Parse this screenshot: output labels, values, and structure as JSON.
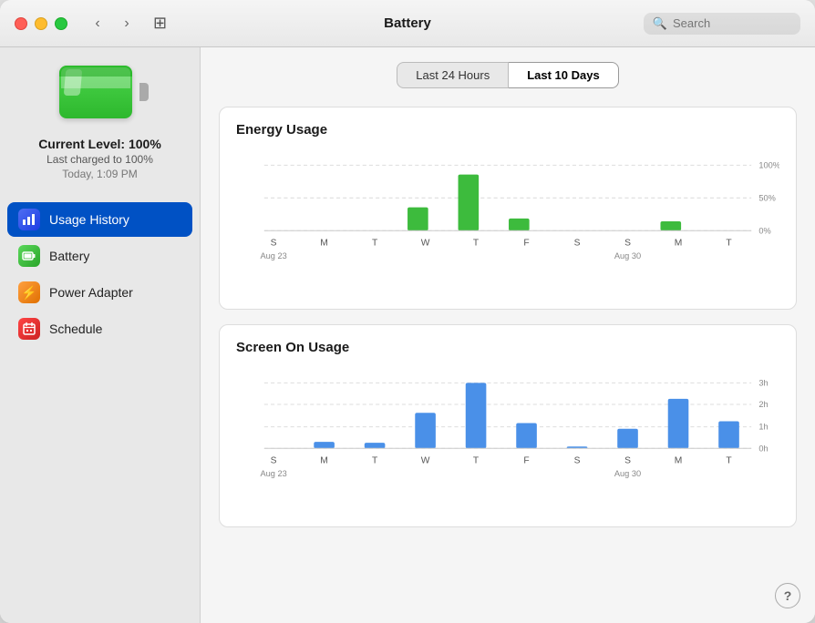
{
  "window": {
    "title": "Battery"
  },
  "titlebar": {
    "back_label": "‹",
    "forward_label": "›",
    "grid_icon": "⊞",
    "search_placeholder": "Search"
  },
  "sidebar": {
    "battery_level_label": "Current Level: 100%",
    "battery_charged_label": "Last charged to 100%",
    "battery_time_label": "Today, 1:09 PM",
    "nav_items": [
      {
        "id": "usage-history",
        "label": "Usage History",
        "icon": "📊",
        "icon_class": "icon-usage",
        "active": true
      },
      {
        "id": "battery",
        "label": "Battery",
        "icon": "🔋",
        "icon_class": "icon-battery-sm",
        "active": false
      },
      {
        "id": "power-adapter",
        "label": "Power Adapter",
        "icon": "⚡",
        "icon_class": "icon-power",
        "active": false
      },
      {
        "id": "schedule",
        "label": "Schedule",
        "icon": "📅",
        "icon_class": "icon-schedule",
        "active": false
      }
    ]
  },
  "tabs": [
    {
      "id": "last-24h",
      "label": "Last 24 Hours",
      "active": false
    },
    {
      "id": "last-10d",
      "label": "Last 10 Days",
      "active": true
    }
  ],
  "energy_chart": {
    "title": "Energy Usage",
    "y_labels": [
      "100%",
      "50%",
      "0%"
    ],
    "x_labels": [
      "S",
      "M",
      "T",
      "W",
      "T",
      "F",
      "S",
      "S",
      "M",
      "T"
    ],
    "x_dates": [
      "Aug 23",
      "",
      "",
      "",
      "",
      "",
      "",
      "Aug 30",
      "",
      ""
    ],
    "bars": [
      {
        "day": "S",
        "value": 0
      },
      {
        "day": "M",
        "value": 0
      },
      {
        "day": "T",
        "value": 0
      },
      {
        "day": "W",
        "value": 35
      },
      {
        "day": "T",
        "value": 85
      },
      {
        "day": "F",
        "value": 18
      },
      {
        "day": "S",
        "value": 0
      },
      {
        "day": "S",
        "value": 0
      },
      {
        "day": "M",
        "value": 14
      },
      {
        "day": "T",
        "value": 0
      }
    ],
    "bar_color": "#3dbb3d"
  },
  "screen_chart": {
    "title": "Screen On Usage",
    "y_labels": [
      "3h",
      "2h",
      "1h",
      "0h"
    ],
    "x_labels": [
      "S",
      "M",
      "T",
      "W",
      "T",
      "F",
      "S",
      "S",
      "M",
      "T"
    ],
    "x_dates": [
      "Aug 23",
      "",
      "",
      "",
      "",
      "",
      "",
      "Aug 30",
      "",
      ""
    ],
    "bars": [
      {
        "day": "S",
        "value": 0
      },
      {
        "day": "M",
        "value": 10
      },
      {
        "day": "T",
        "value": 8
      },
      {
        "day": "W",
        "value": 55
      },
      {
        "day": "T",
        "value": 100
      },
      {
        "day": "F",
        "value": 38
      },
      {
        "day": "S",
        "value": 2
      },
      {
        "day": "S",
        "value": 30
      },
      {
        "day": "M",
        "value": 75
      },
      {
        "day": "T",
        "value": 42
      }
    ],
    "bar_color": "#4a90e8"
  },
  "help_label": "?"
}
